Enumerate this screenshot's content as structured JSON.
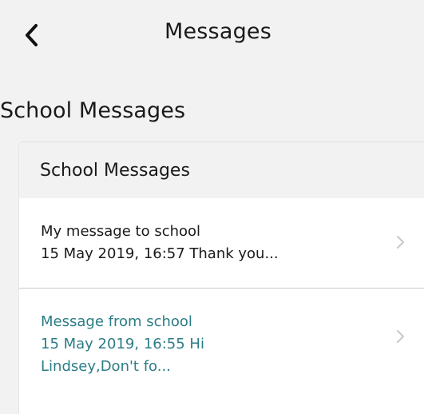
{
  "nav": {
    "title": "Messages",
    "back_icon": "chevron-left-icon"
  },
  "section": {
    "heading": "School Messages"
  },
  "card": {
    "header": "School Messages",
    "messages": [
      {
        "subject": "My message to school",
        "preview": "15 May 2019, 16:57 Thank you...",
        "preview_cont": "",
        "unread": false,
        "chevron_icon": "chevron-right-icon"
      },
      {
        "subject": "Message from school",
        "preview": "15 May 2019, 16:55 Hi",
        "preview_cont": "Lindsey,Don't fo...",
        "unread": true,
        "chevron_icon": "chevron-right-icon"
      }
    ]
  },
  "colors": {
    "background": "#f2f2f2",
    "card": "#ffffff",
    "unread_text": "#2b7c86",
    "chevron": "#c7c7cc"
  }
}
